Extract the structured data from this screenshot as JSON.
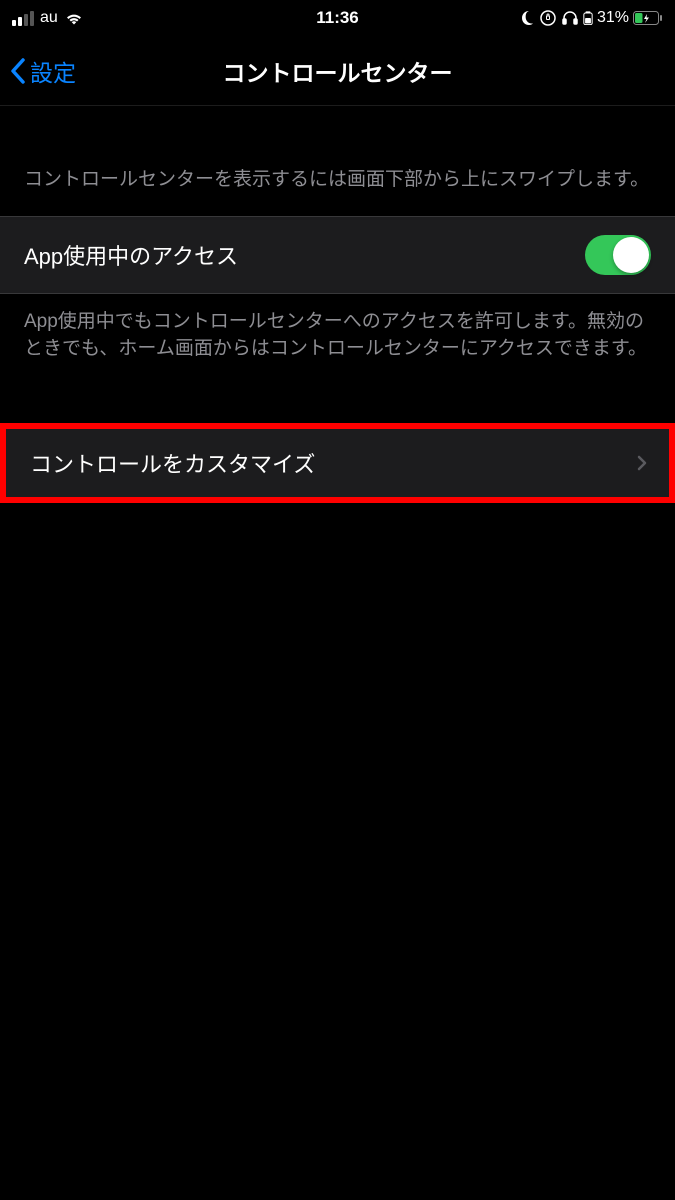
{
  "statusBar": {
    "carrier": "au",
    "time": "11:36",
    "batteryPercent": "31%"
  },
  "nav": {
    "backLabel": "設定",
    "title": "コントロールセンター"
  },
  "section1": {
    "description": "コントロールセンターを表示するには画面下部から上にスワイプします。"
  },
  "toggle": {
    "label": "App使用中のアクセス",
    "footer": "App使用中でもコントロールセンターへのアクセスを許可します。無効のときでも、ホーム画面からはコントロールセンターにアクセスできます。",
    "on": true
  },
  "customizeRow": {
    "label": "コントロールをカスタマイズ"
  }
}
